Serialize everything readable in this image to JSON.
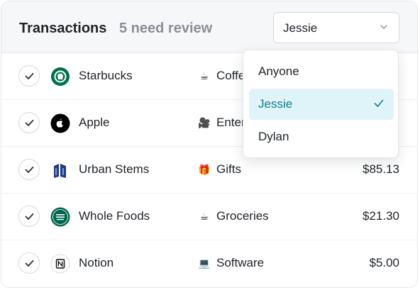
{
  "header": {
    "title": "Transactions",
    "subtitle": "5 need review",
    "assignee_select": {
      "value": "Jessie"
    }
  },
  "transactions": [
    {
      "merchant": "Starbucks",
      "category": "Coffee",
      "category_icon": "coffee-icon",
      "amount": "",
      "logo": "starbucks-logo"
    },
    {
      "merchant": "Apple",
      "category": "Entertainment",
      "category_icon": "camera-icon",
      "amount": "",
      "logo": "apple-logo"
    },
    {
      "merchant": "Urban Stems",
      "category": "Gifts",
      "category_icon": "gift-icon",
      "amount": "$85.13",
      "logo": "urban-stems-logo"
    },
    {
      "merchant": "Whole Foods",
      "category": "Groceries",
      "category_icon": "coffee-icon",
      "amount": "$21.30",
      "logo": "whole-foods-logo"
    },
    {
      "merchant": "Notion",
      "category": "Software",
      "category_icon": "laptop-icon",
      "amount": "$5.00",
      "logo": "notion-logo"
    }
  ],
  "dropdown": {
    "options": [
      {
        "label": "Anyone",
        "selected": false
      },
      {
        "label": "Jessie",
        "selected": true
      },
      {
        "label": "Dylan",
        "selected": false
      }
    ]
  },
  "colors": {
    "accent": "#127c88",
    "selected_bg": "#dff4f8",
    "starbucks_green": "#00704a",
    "whole_foods_green": "#00674b",
    "urban_stems_blue": "#1e3a8a"
  }
}
